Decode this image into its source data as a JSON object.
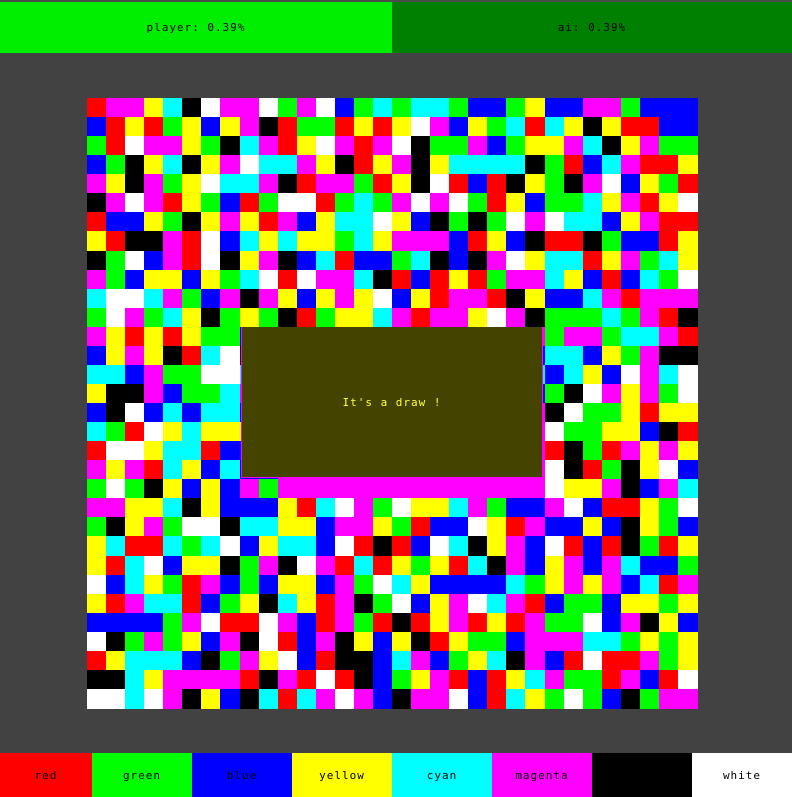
{
  "scores": {
    "player": {
      "label": "player: 0.39%",
      "color": "#00ee00"
    },
    "ai": {
      "label": "ai: 0.39%",
      "color": "#008000"
    }
  },
  "message": {
    "text": "It's a draw !",
    "background": "#444400",
    "text_color": "#ffff44",
    "border_color": "#ff00ff"
  },
  "palette": [
    {
      "name": "red",
      "label": "red",
      "color": "#ff0000"
    },
    {
      "name": "green",
      "label": "green",
      "color": "#00ff00"
    },
    {
      "name": "blue",
      "label": "blue",
      "color": "#0000ff"
    },
    {
      "name": "yellow",
      "label": "yellow",
      "color": "#ffff00"
    },
    {
      "name": "cyan",
      "label": "cyan",
      "color": "#00ffff"
    },
    {
      "name": "magenta",
      "label": "magenta",
      "color": "#ff00ff"
    },
    {
      "name": "black",
      "label": "black",
      "color": "#000000"
    },
    {
      "name": "white",
      "label": "white",
      "color": "#ffffff"
    }
  ],
  "board": {
    "grid_size": 32,
    "color_codes": "R=red G=green B=blue Y=yellow C=cyan M=magenta K=black W=white",
    "rows": [
      "RMMYCKWMMWGMWBGCGCCGBBGYBBMMGBBB",
      "BRYRGYBYMKRGGRYRYWMBYGCRCYKYRRBB",
      "GRWMMYGKCMRYWMRMWKGGMBGYYMCKYMGG",
      "BGKYCKYMWCCMYKRYMKYCCCCKGRBCMRRY",
      "MYKMGYWCCMKRMMGRYKWRBRKYGKMWBYGR",
      "KMWMRYGBRGWWRGCGMWMWGRYBGGCYMRYW",
      "RBBYGKYMYRMBYCCWYBKGKGWMWCCBYMRR",
      "YRKKMRWBCYCYYGCYMMMBRYBKRRKGBBRY",
      "KGWBMRWKYMKBCRBBGCKBKMWYCCRYMGCY",
      "MGBYYBYGCWRWMMCKRBRYRGMMCYBRBCGW",
      "CWWCMGBMKMYBYMYWBYRMMRKYBBCMRMMM",
      "GWMGCYKGYGKRGYYCMRMMYWMKGGGCGMRK",
      "MYRYRYGGBMRMMMMMMRYYWWYMGMMGCCMR",
      "BYMYKRCWKMMMMYRCCCRMMCYBCCBYGMKK",
      "CCBMGGWWCMYYYGMMBCKKYWBCBCYBWMCW",
      "YKKMBGGCMMMMMMMMMMMMMMMBGKWMYMGW",
      "BKWBCBCCBMMMMMMMMMMMMMMMKWGGYRYY",
      "CGRWYCYYYMMMMMMMMMMMMMMMWGGYYBKR",
      "RWWYCCRBBGMMMMMMMMMMMMMMRKGRMYMY",
      "MYMRCYBCBBMMMMMMMMMMMMMMWKRGKYWB",
      "GWGKYBYBMGMMMMMMMMMMMMMMWYYMKBMC",
      "MMYYCKYBBBYRCWMGWYYCMGBBMWBRRYGW",
      "GKYMGWWKCCYYBMMYGRBBWYRMBBYBKYGB",
      "YCRRCGCWBYCCBWRKRBWCKYMBWRBRKGRY",
      "YRCWBYYKGMKWMRCRYGYRCKMBYMBMCBBG",
      "WBCYGRMBGBYYBMGWCYBBBBCGYMYMBCRM",
      "YRMCCRBGYKCYRMKGWBYMWCMRBGGBYYGY",
      "BBBBGMWRRWMBRMGRKRYMRYRMGGWBMKYB",
      "WKGMGYBMKWRBMKYBYKRYGGBMMMCCGYGY",
      "RYCCCBKGMYWBRKKBCMBGYCKMBRWRRMGY",
      "KKCYMMMMRKMRWRKBGYMRBRYCMGGRMBRW",
      "WWCWMKYBKCRCMWMBKMMWBRCYGWGBKGMM"
    ]
  }
}
